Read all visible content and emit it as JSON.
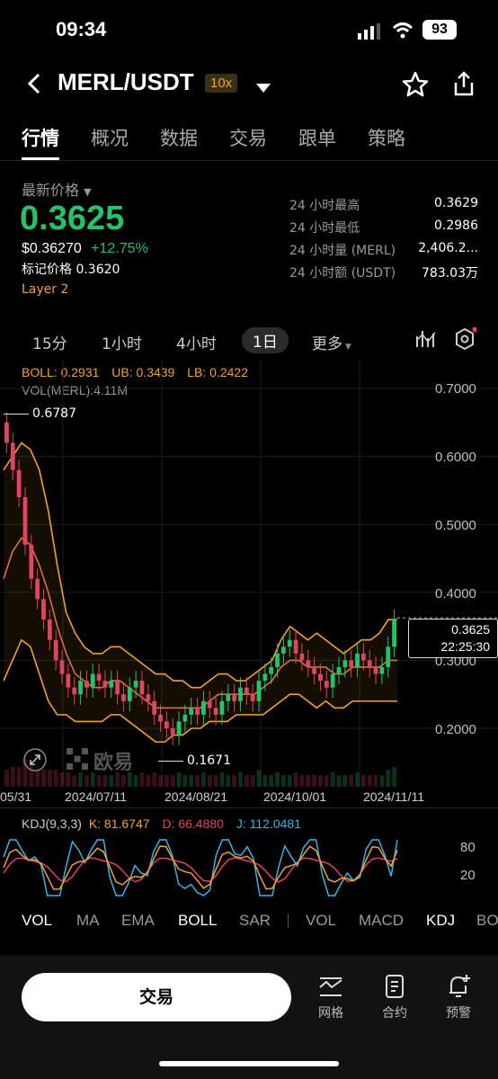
{
  "status": {
    "time": "09:34",
    "battery": "93"
  },
  "header": {
    "pair": "MERL/USDT",
    "leverage": "10x"
  },
  "tabs": [
    "行情",
    "概况",
    "数据",
    "交易",
    "跟单",
    "策略"
  ],
  "price": {
    "latest_label": "最新价格",
    "last": "0.3625",
    "usd": "$0.36270",
    "change": "+12.75%",
    "mark": "标记价格 0.3620",
    "tag": "Layer 2"
  },
  "stats": [
    {
      "label": "24 小时最高",
      "value": "0.3629"
    },
    {
      "label": "24 小时最低",
      "value": "0.2986"
    },
    {
      "label": "24 小时量 (MERL)",
      "value": "2,406.2..."
    },
    {
      "label": "24 小时额 (USDT)",
      "value": "783.03万"
    }
  ],
  "intervals": [
    "15分",
    "1小时",
    "4小时",
    "1日",
    "更多"
  ],
  "active_interval": "1日",
  "boll": {
    "boll": "BOLL: 0.2931",
    "ub": "UB: 0.3439",
    "lb": "LB: 0.2422",
    "vol": "VOL(MERL):4.11M"
  },
  "watermark": "欧易",
  "chart_data": {
    "type": "candlestick",
    "y_ticks": [
      "0.7000",
      "0.6000",
      "0.5000",
      "0.4000",
      "0.3000",
      "0.2000"
    ],
    "ylim": [
      0.12,
      0.74
    ],
    "x_ticks": [
      "05/31",
      "2024/07/11",
      "2024/08/21",
      "2024/10/01",
      "2024/11/11"
    ],
    "high_marker": "0.6787",
    "low_marker": "0.1671",
    "current_price": "0.3625",
    "countdown": "22:25:30",
    "closes": [
      0.62,
      0.58,
      0.54,
      0.47,
      0.42,
      0.39,
      0.36,
      0.33,
      0.3,
      0.28,
      0.26,
      0.25,
      0.27,
      0.26,
      0.28,
      0.27,
      0.26,
      0.27,
      0.25,
      0.24,
      0.26,
      0.27,
      0.25,
      0.24,
      0.22,
      0.21,
      0.2,
      0.19,
      0.21,
      0.22,
      0.23,
      0.22,
      0.24,
      0.23,
      0.22,
      0.24,
      0.25,
      0.24,
      0.26,
      0.25,
      0.24,
      0.27,
      0.28,
      0.29,
      0.31,
      0.32,
      0.33,
      0.31,
      0.3,
      0.29,
      0.28,
      0.27,
      0.26,
      0.28,
      0.29,
      0.3,
      0.29,
      0.31,
      0.3,
      0.29,
      0.28,
      0.29,
      0.32,
      0.36
    ],
    "upper_band": [
      0.58,
      0.6,
      0.62,
      0.61,
      0.58,
      0.52,
      0.44,
      0.37,
      0.34,
      0.32,
      0.31,
      0.31,
      0.32,
      0.32,
      0.31,
      0.3,
      0.29,
      0.28,
      0.28,
      0.27,
      0.27,
      0.26,
      0.26,
      0.27,
      0.28,
      0.28,
      0.27,
      0.27,
      0.28,
      0.29,
      0.3,
      0.33,
      0.35,
      0.34,
      0.33,
      0.34,
      0.33,
      0.32,
      0.31,
      0.32,
      0.33,
      0.33,
      0.34,
      0.36,
      0.36
    ],
    "middle_band": [
      0.42,
      0.46,
      0.48,
      0.47,
      0.44,
      0.4,
      0.35,
      0.31,
      0.28,
      0.27,
      0.26,
      0.26,
      0.27,
      0.27,
      0.26,
      0.25,
      0.24,
      0.23,
      0.23,
      0.23,
      0.23,
      0.23,
      0.23,
      0.24,
      0.25,
      0.25,
      0.25,
      0.25,
      0.25,
      0.26,
      0.27,
      0.29,
      0.3,
      0.3,
      0.29,
      0.29,
      0.29,
      0.28,
      0.28,
      0.29,
      0.29,
      0.29,
      0.29,
      0.3,
      0.3
    ],
    "lower_band": [
      0.27,
      0.3,
      0.33,
      0.32,
      0.28,
      0.24,
      0.22,
      0.22,
      0.21,
      0.21,
      0.21,
      0.21,
      0.22,
      0.22,
      0.21,
      0.2,
      0.19,
      0.18,
      0.18,
      0.19,
      0.19,
      0.2,
      0.2,
      0.21,
      0.21,
      0.21,
      0.22,
      0.22,
      0.22,
      0.22,
      0.23,
      0.24,
      0.25,
      0.25,
      0.24,
      0.23,
      0.24,
      0.23,
      0.23,
      0.24,
      0.24,
      0.24,
      0.24,
      0.24,
      0.24
    ]
  },
  "kdj": {
    "label": "KDJ(9,3,3)",
    "k": "K: 81.6747",
    "d": "D: 66.4880",
    "j": "J: 112.0481",
    "ticks": [
      "80",
      "20"
    ]
  },
  "indicator_tabs": [
    "VOL",
    "MA",
    "EMA",
    "BOLL",
    "SAR",
    "VOL",
    "MACD",
    "KDJ",
    "BO"
  ],
  "bottom": {
    "trade": "交易",
    "grid": "网格",
    "contract": "合约",
    "alert": "预警"
  }
}
